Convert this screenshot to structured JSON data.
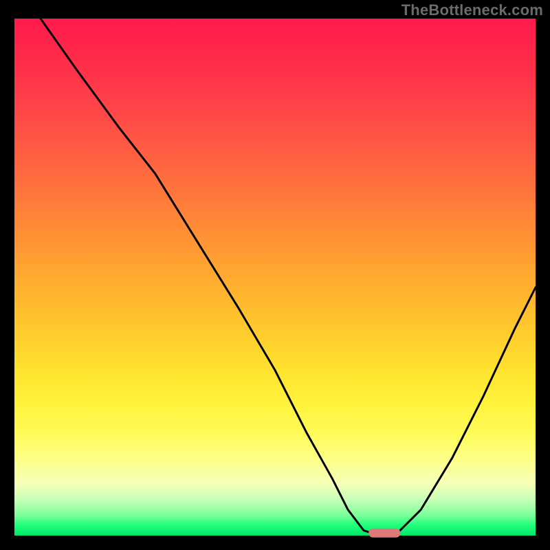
{
  "watermark": "TheBottleneck.com",
  "colors": {
    "frame": "#000000",
    "curve": "#000000",
    "marker": "#e07a7a",
    "gradient_top": "#ff1a4d",
    "gradient_bottom": "#00e56a"
  },
  "chart_data": {
    "type": "line",
    "title": "",
    "xlabel": "",
    "ylabel": "",
    "xlim": [
      0,
      100
    ],
    "ylim": [
      0,
      100
    ],
    "series": [
      {
        "name": "bottleneck-curve",
        "x": [
          5,
          12,
          20,
          27,
          35,
          43,
          50,
          56,
          61,
          64,
          67,
          70,
          73,
          78,
          84,
          90,
          96,
          100
        ],
        "y": [
          100,
          90,
          79,
          70,
          57,
          44,
          32,
          20,
          11,
          5,
          1,
          0,
          0,
          5,
          15,
          27,
          40,
          48
        ]
      }
    ],
    "annotations": [
      {
        "name": "optimal-marker",
        "x": 71,
        "y": 0.5,
        "shape": "rounded-bar"
      }
    ]
  }
}
